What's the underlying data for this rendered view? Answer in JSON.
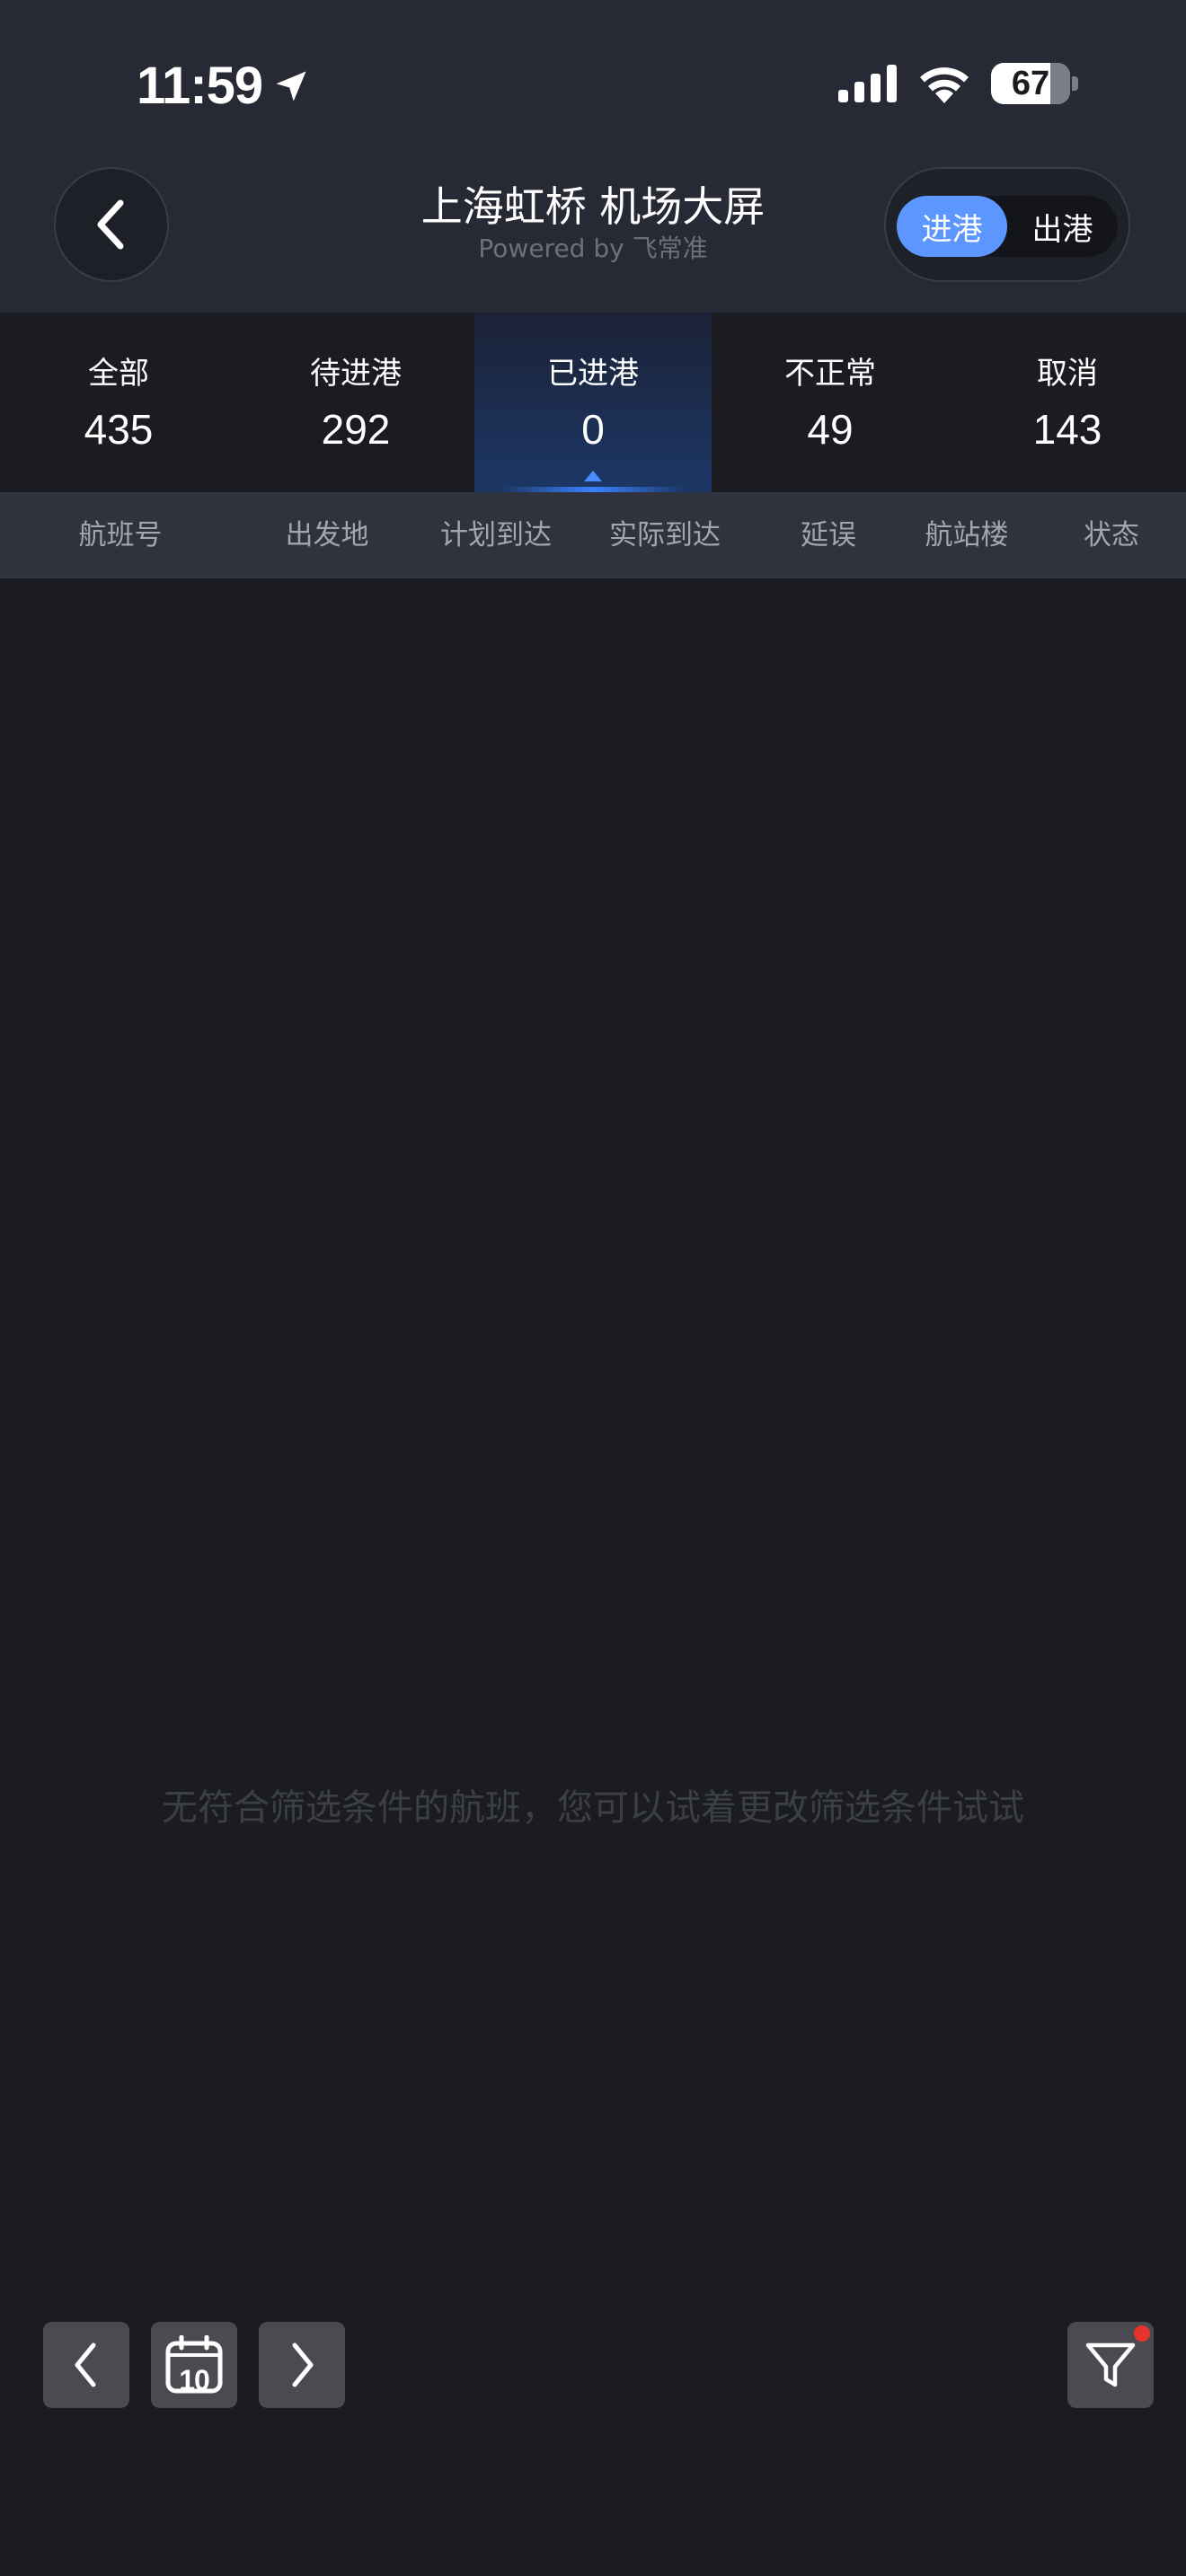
{
  "status_bar": {
    "time": "11:59",
    "battery": "67",
    "icons": [
      "location-arrow-icon",
      "cellular-signal-icon",
      "wifi-icon",
      "battery-icon"
    ]
  },
  "header": {
    "title": "上海虹桥 机场大屏",
    "subtitle": "Powered by 飞常准",
    "back_icon": "chevron-left-icon",
    "toggle": {
      "options": [
        "进港",
        "出港"
      ],
      "selected": "进港"
    }
  },
  "tabs": [
    {
      "label": "全部",
      "count": "435"
    },
    {
      "label": "待进港",
      "count": "292"
    },
    {
      "label": "已进港",
      "count": "0"
    },
    {
      "label": "不正常",
      "count": "49"
    },
    {
      "label": "取消",
      "count": "143"
    }
  ],
  "active_tab": "已进港",
  "columns": [
    "航班号",
    "出发地",
    "计划到达",
    "实际到达",
    "延误",
    "航站楼",
    "状态"
  ],
  "empty_message": "无符合筛选条件的航班，您可以试着更改筛选条件试试",
  "bottom_bar": {
    "prev_icon": "chevron-left-icon",
    "calendar_icon": "calendar-icon",
    "calendar_day": "10",
    "next_icon": "chevron-right-icon",
    "filter_icon": "filter-icon",
    "filter_badge_color": "#e8322c"
  },
  "colors": {
    "background": "#1b1c21",
    "header": "#272a35",
    "accent": "#5c96ff",
    "column_header": "#30333d"
  }
}
